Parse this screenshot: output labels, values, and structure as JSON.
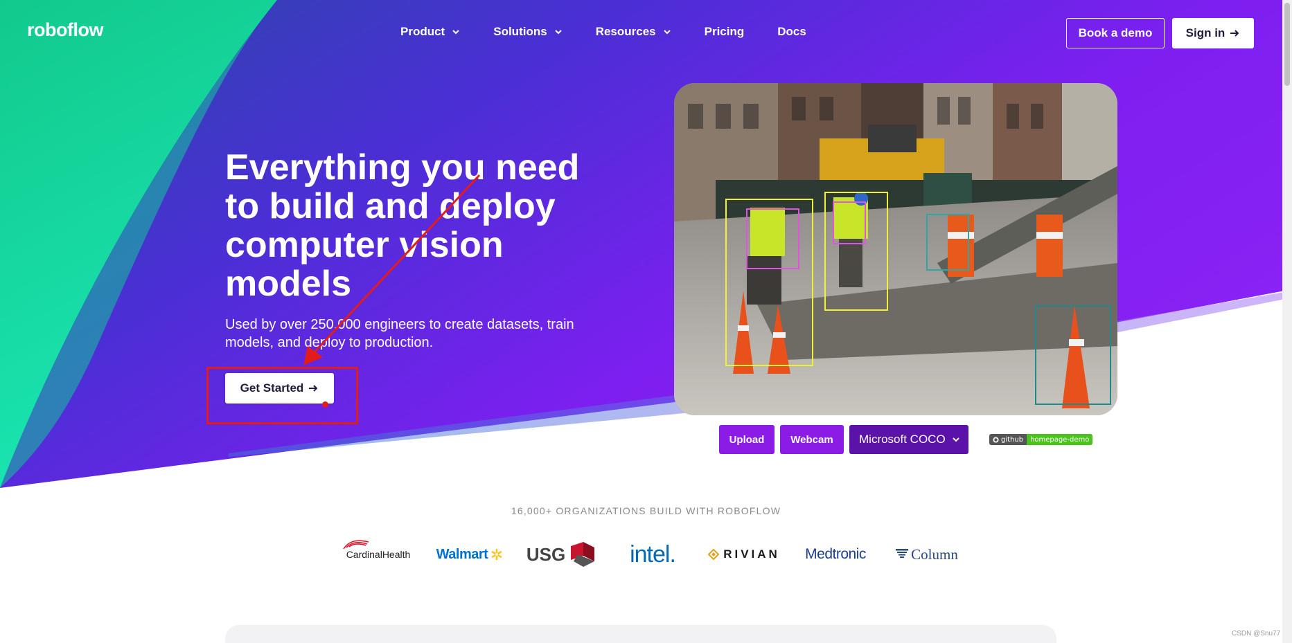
{
  "nav": {
    "logo": "roboflow",
    "items": [
      {
        "label": "Product",
        "has_dropdown": true
      },
      {
        "label": "Solutions",
        "has_dropdown": true
      },
      {
        "label": "Resources",
        "has_dropdown": true
      },
      {
        "label": "Pricing",
        "has_dropdown": false
      },
      {
        "label": "Docs",
        "has_dropdown": false
      }
    ],
    "book_demo": "Book a demo",
    "sign_in": "Sign in"
  },
  "hero": {
    "headline": "Everything you need to build and deploy computer vision models",
    "subline": "Used by over 250,000 engineers to create datasets, train models, and deploy to production.",
    "cta": "Get Started"
  },
  "demo": {
    "upload": "Upload",
    "webcam": "Webcam",
    "model_select": "Microsoft COCO",
    "badge_left": "github",
    "badge_right": "homepage-demo"
  },
  "orgs": {
    "title": "16,000+ ORGANIZATIONS BUILD WITH ROBOFLOW",
    "logos": [
      "CardinalHealth",
      "Walmart",
      "USG",
      "intel.",
      "RIVIAN",
      "Medtronic",
      "Column"
    ]
  },
  "watermark": "CSDN @Snu77",
  "colors": {
    "purple": "#8b1ce6",
    "deep_purple": "#5b12a8",
    "teal": "#1ae0a4",
    "annotation_red": "#e41b1b"
  }
}
